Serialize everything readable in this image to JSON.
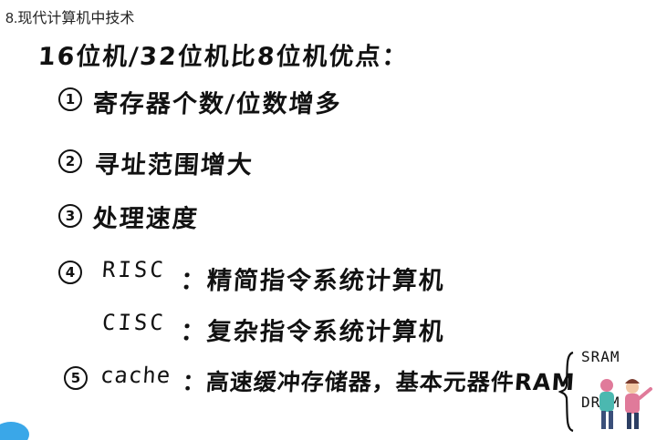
{
  "page": {
    "title": "8.现代计算机中技术"
  },
  "notes": {
    "heading": "16位机/32位机比8位机优点：",
    "items": [
      {
        "num": "1",
        "text": "寄存器个数/位数增多"
      },
      {
        "num": "2",
        "text": "寻址范围增大"
      },
      {
        "num": "3",
        "text": "处理速度"
      },
      {
        "num": "4",
        "label": "RISC",
        "text": "：精简指令系统计算机"
      },
      {
        "label": "CISC",
        "text": "：复杂指令系统计算机"
      },
      {
        "num": "5",
        "label": "cache",
        "text": "：高速缓冲存储器，基本元器件RAM"
      }
    ],
    "memory_types": [
      "SRAM",
      "DRAM"
    ]
  },
  "colors": {
    "ink": "#111111",
    "background": "#ffffff",
    "deco_blue": "#3aa7e8",
    "deco_pink": "#e07a9a",
    "deco_teal": "#4bb8b0"
  }
}
